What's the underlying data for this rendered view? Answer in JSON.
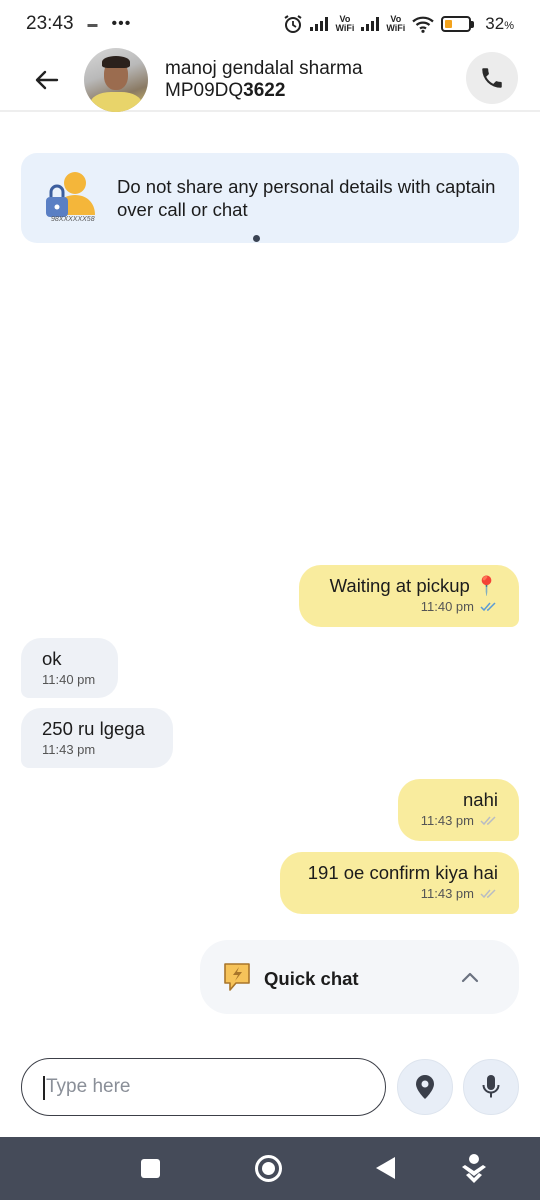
{
  "status_bar": {
    "time": "23:43",
    "battery_percent": "32",
    "battery_suffix": "%",
    "network_label_1": "Vo\nWiFi",
    "network_label_2": "Vo\nWiFi"
  },
  "header": {
    "driver_name": "manoj gendalal sharma",
    "vehicle_prefix": "MP09DQ",
    "vehicle_suffix": "3622"
  },
  "safety_banner": {
    "text": "Do not share any personal details with captain over call or chat",
    "masked_number": "98XXXXXX58"
  },
  "messages": [
    {
      "direction": "out",
      "text": "Waiting at pickup 📍",
      "time": "11:40 pm",
      "read": true
    },
    {
      "direction": "in",
      "text": "ok",
      "time": "11:40 pm"
    },
    {
      "direction": "in",
      "text": "250 ru lgega",
      "time": "11:43 pm"
    },
    {
      "direction": "out",
      "text": "nahi",
      "time": "11:43 pm",
      "read": false
    },
    {
      "direction": "out",
      "text": "191 oe confirm kiya hai",
      "time": "11:43 pm",
      "read": false
    }
  ],
  "quick_chat": {
    "label": "Quick chat"
  },
  "composer": {
    "placeholder": "Type here",
    "value": ""
  },
  "colors": {
    "outgoing_bubble": "#f9ec9e",
    "incoming_bubble": "#eef1f6",
    "banner_bg": "#e9f1fb",
    "read_tick": "#5b9bd5",
    "unread_tick": "#b8bcc4",
    "nav_bar": "#454b59"
  },
  "icons": {
    "back": "arrow-left-icon",
    "call": "phone-icon",
    "location": "location-pin-icon",
    "mic": "microphone-icon",
    "quick_chat": "lightning-chat-icon",
    "chevron": "chevron-up-icon"
  }
}
